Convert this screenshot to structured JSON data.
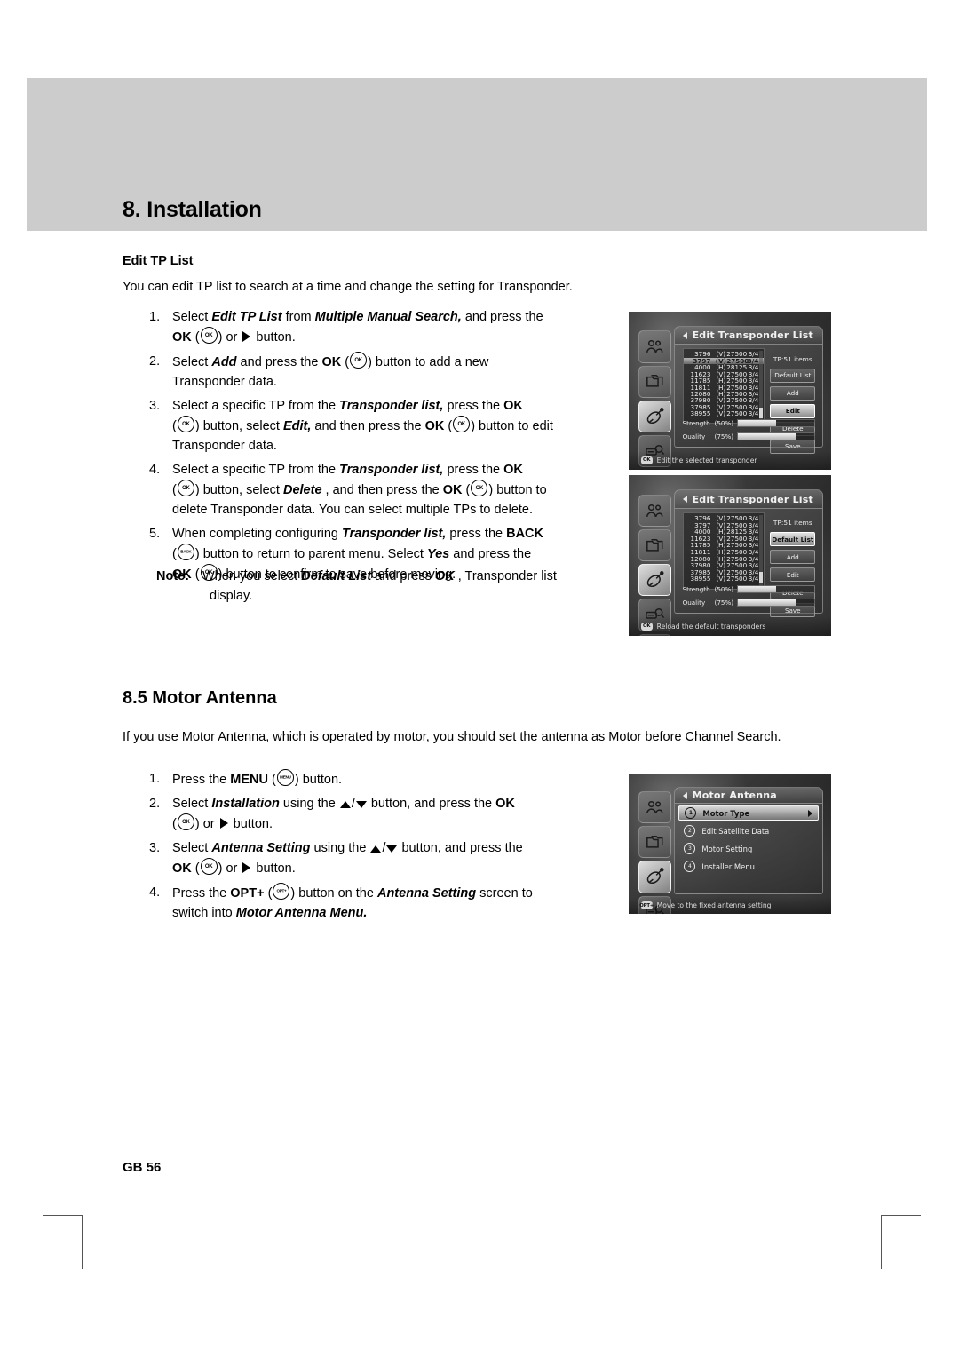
{
  "page": {
    "chapter_title": "8. Installation",
    "page_number": "GB 56"
  },
  "edit_tp": {
    "heading": "Edit TP List",
    "intro": "You can edit TP list to search at a time and change the setting for Transponder.",
    "steps": [
      {
        "num": "1.",
        "text": "Select Edit TP List from Multiple Manual Search, and press the OK (  ) or   button."
      },
      {
        "num": "2.",
        "text": "Select Add and press the OK (  ) button to add a new Transponder data."
      },
      {
        "num": "3.",
        "text": "Select a specific TP from the Transponder list, press the OK (  ) button, select Edit, and then press the OK (  ) button to edit Transponder data."
      },
      {
        "num": "4.",
        "text": "Select a specific TP from the Transponder list, press the OK (  ) button, select Delete , and then press the OK (  ) button to delete Transponder data. You can select multiple TPs to delete."
      },
      {
        "num": "5.",
        "text": "When completing configuring Transponder list, press the BACK (  ) button to return to parent menu. Select Yes and press the OK (  ) button to confirm to save before moving."
      }
    ],
    "note_label": "Note:",
    "note_text": "When you select Default List and press OK , Transponder list display."
  },
  "motor": {
    "heading": "8.5 Motor Antenna",
    "intro": "If you use Motor Antenna, which is operated by motor, you should set the antenna as Motor before Channel Search.",
    "steps": [
      {
        "num": "1.",
        "text": "Press the MENU (  ) button."
      },
      {
        "num": "2.",
        "text": "Select Installation using the  /  button, and press the OK (  ) or   button."
      },
      {
        "num": "3.",
        "text": "Select Antenna Setting using the  /  button, and press the OK (  ) or   button."
      },
      {
        "num": "4.",
        "text": "Press the OPT+ (  ) button on the Antenna Setting screen to switch into Motor Antenna Menu."
      }
    ]
  },
  "keys": {
    "ok": "OK",
    "back": "BACK",
    "menu": "MENU",
    "opt": "OPT+"
  },
  "osd1": {
    "title": "Edit Transponder List",
    "count_label": "TP:51 items",
    "transponders": [
      {
        "freq": "3796",
        "pol": "(V)",
        "sr": "27500",
        "fec": "3/4",
        "selected": false
      },
      {
        "freq": "3797",
        "pol": "(V)",
        "sr": "27500",
        "fec": "3/4",
        "selected": true
      },
      {
        "freq": "4000",
        "pol": "(H)",
        "sr": "28125",
        "fec": "3/4",
        "selected": false
      },
      {
        "freq": "11623",
        "pol": "(V)",
        "sr": "27500",
        "fec": "3/4",
        "selected": false
      },
      {
        "freq": "11785",
        "pol": "(H)",
        "sr": "27500",
        "fec": "3/4",
        "selected": false
      },
      {
        "freq": "11811",
        "pol": "(H)",
        "sr": "27500",
        "fec": "3/4",
        "selected": false
      },
      {
        "freq": "12080",
        "pol": "(H)",
        "sr": "27500",
        "fec": "3/4",
        "selected": false
      },
      {
        "freq": "37980",
        "pol": "(V)",
        "sr": "27500",
        "fec": "3/4",
        "selected": false
      },
      {
        "freq": "37985",
        "pol": "(V)",
        "sr": "27500",
        "fec": "3/4",
        "selected": false
      },
      {
        "freq": "38955",
        "pol": "(V)",
        "sr": "27500",
        "fec": "3/4",
        "selected": false
      }
    ],
    "buttons": [
      {
        "label": "Default List",
        "selected": false
      },
      {
        "label": "Add",
        "selected": false
      },
      {
        "label": "Edit",
        "selected": true
      },
      {
        "label": "Delete",
        "selected": false
      },
      {
        "label": "Save",
        "selected": false
      }
    ],
    "signal": [
      {
        "label": "Strength",
        "pct": "(50%)",
        "value": 50
      },
      {
        "label": "Quality",
        "pct": "(75%)",
        "value": 75
      }
    ],
    "footer_key": "OK",
    "footer_hint": "Edit the selected transponder"
  },
  "osd2": {
    "title": "Edit Transponder List",
    "count_label": "TP:51 items",
    "transponders": [
      {
        "freq": "3796",
        "pol": "(V)",
        "sr": "27500",
        "fec": "3/4",
        "selected": false
      },
      {
        "freq": "3797",
        "pol": "(V)",
        "sr": "27500",
        "fec": "3/4",
        "selected": false
      },
      {
        "freq": "4000",
        "pol": "(H)",
        "sr": "28125",
        "fec": "3/4",
        "selected": false
      },
      {
        "freq": "11623",
        "pol": "(V)",
        "sr": "27500",
        "fec": "3/4",
        "selected": false
      },
      {
        "freq": "11785",
        "pol": "(H)",
        "sr": "27500",
        "fec": "3/4",
        "selected": false
      },
      {
        "freq": "11811",
        "pol": "(H)",
        "sr": "27500",
        "fec": "3/4",
        "selected": false
      },
      {
        "freq": "12080",
        "pol": "(H)",
        "sr": "27500",
        "fec": "3/4",
        "selected": false
      },
      {
        "freq": "37980",
        "pol": "(V)",
        "sr": "27500",
        "fec": "3/4",
        "selected": false
      },
      {
        "freq": "37985",
        "pol": "(V)",
        "sr": "27500",
        "fec": "3/4",
        "selected": false
      },
      {
        "freq": "38955",
        "pol": "(V)",
        "sr": "27500",
        "fec": "3/4",
        "selected": false
      }
    ],
    "buttons": [
      {
        "label": "Default List",
        "selected": true
      },
      {
        "label": "Add",
        "selected": false
      },
      {
        "label": "Edit",
        "selected": false
      },
      {
        "label": "Delete",
        "selected": false
      },
      {
        "label": "Save",
        "selected": false
      }
    ],
    "signal": [
      {
        "label": "Strength",
        "pct": "(50%)",
        "value": 50
      },
      {
        "label": "Quality",
        "pct": "(75%)",
        "value": 75
      }
    ],
    "footer_key": "OK",
    "footer_hint": "Reload the default transponders"
  },
  "osd3": {
    "title": "Motor Antenna",
    "items": [
      {
        "num": "1",
        "label": "Motor Type",
        "selected": true,
        "arrow": true
      },
      {
        "num": "2",
        "label": "Edit Satellite Data",
        "selected": false,
        "arrow": false
      },
      {
        "num": "3",
        "label": "Motor Setting",
        "selected": false,
        "arrow": false
      },
      {
        "num": "4",
        "label": "Installer Menu",
        "selected": false,
        "arrow": false
      }
    ],
    "footer_key": "OPT+",
    "footer_hint": "Move to the fixed antenna setting"
  },
  "rail_icons": [
    "users-icon",
    "folder-copy-icon",
    "satellite-dish-icon",
    "search-tuner-icon",
    "tools-icon"
  ]
}
